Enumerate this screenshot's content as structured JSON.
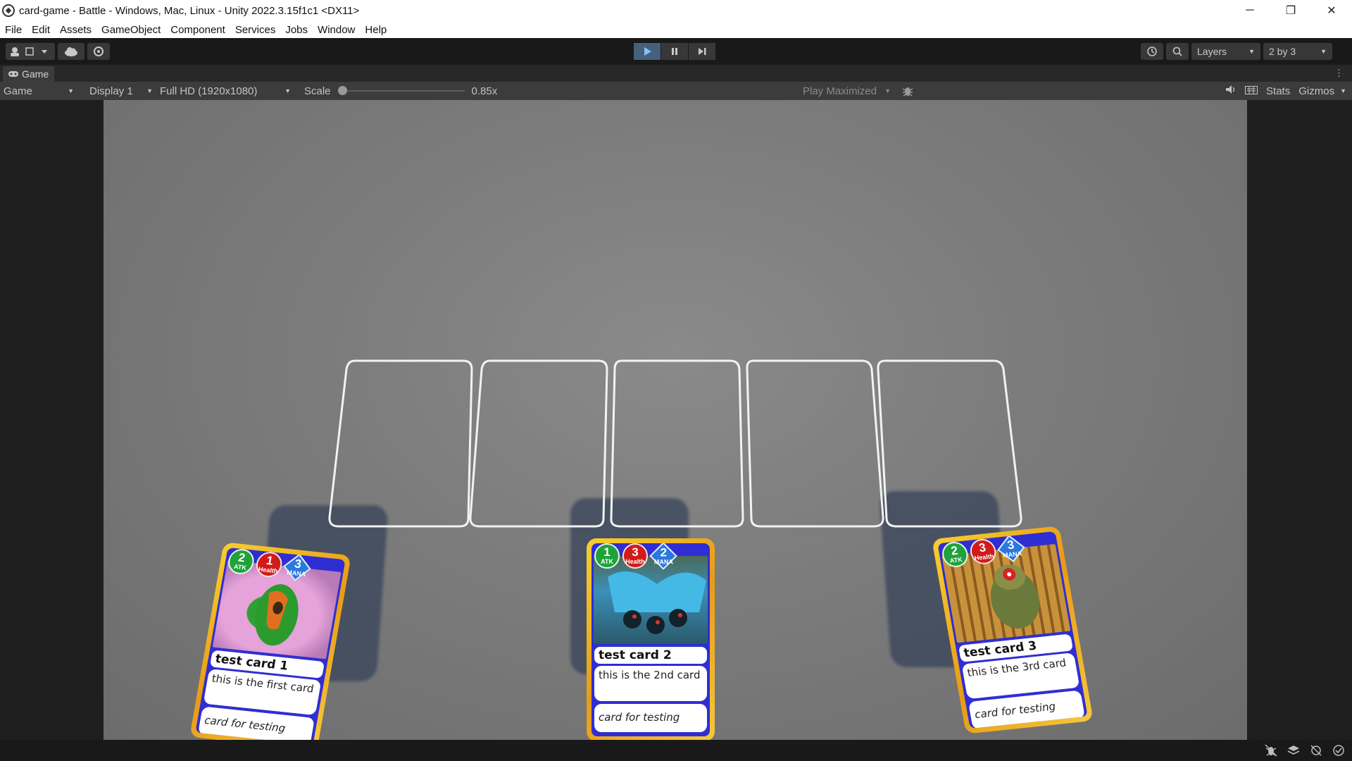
{
  "window": {
    "title": "card-game - Battle - Windows, Mac, Linux - Unity 2022.3.15f1c1 <DX11>",
    "minimize": "─",
    "restore": "❐",
    "close": "✕"
  },
  "menu": [
    "File",
    "Edit",
    "Assets",
    "GameObject",
    "Component",
    "Services",
    "Jobs",
    "Window",
    "Help"
  ],
  "toolbar": {
    "layers_label": "Layers",
    "layout_label": "2 by 3",
    "play_state": "playing"
  },
  "game_tab": {
    "label": "Game",
    "view_select": "Game",
    "display_select": "Display 1",
    "resolution_select": "Full HD (1920x1080)",
    "scale_label": "Scale",
    "scale_value": "0.85x",
    "scale_fraction": 0.0,
    "play_mode": "Play Maximized",
    "stats_label": "Stats",
    "gizmos_label": "Gizmos"
  },
  "cards": [
    {
      "name": "test card 1",
      "description": "this is the first card",
      "flavor": "card for testing",
      "atk": "2",
      "atk_label": "ATK",
      "health": "1",
      "health_label": "Health",
      "mana": "3",
      "mana_label": "MANA"
    },
    {
      "name": "test card 2",
      "description": "this is the 2nd card",
      "flavor": "card for testing",
      "atk": "1",
      "atk_label": "ATK",
      "health": "3",
      "health_label": "Health",
      "mana": "2",
      "mana_label": "MANA"
    },
    {
      "name": "test card 3",
      "description": "this is the 3rd card",
      "flavor": "card for testing",
      "atk": "2",
      "atk_label": "ATK",
      "health": "3",
      "health_label": "Health",
      "mana": "3",
      "mana_label": "MANA"
    }
  ],
  "colors": {
    "card_border": "#f2c12e",
    "card_body": "#2f2ed2",
    "atk": "#1fa23a",
    "health": "#d11b1b",
    "mana": "#2b78df",
    "slot_outline": "#f2f2f2"
  }
}
